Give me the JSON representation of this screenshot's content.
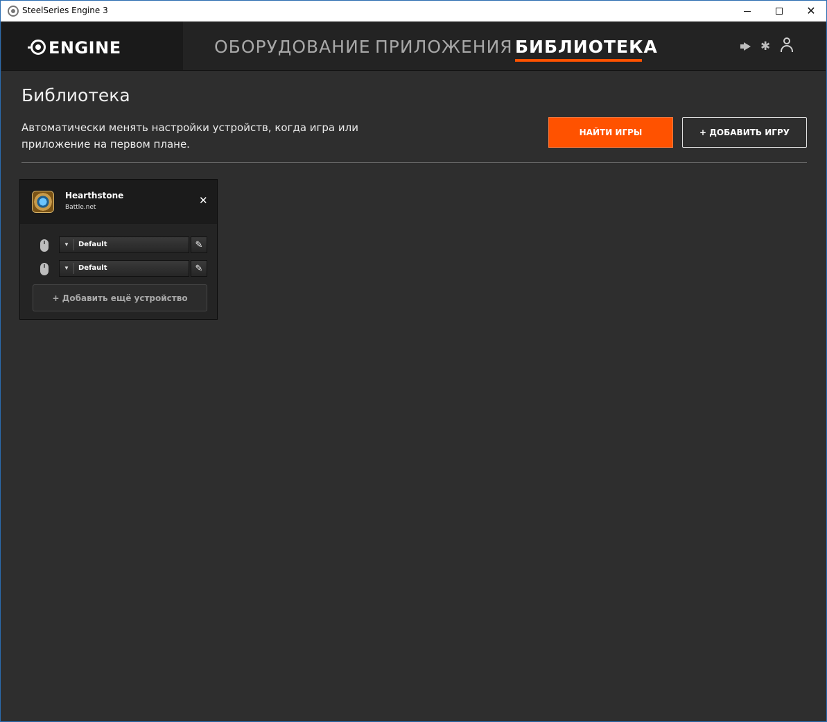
{
  "window": {
    "title": "SteelSeries Engine 3",
    "close_glyph": "✕"
  },
  "nav": {
    "logo_text": "ENGINE",
    "tabs": [
      {
        "label": "ОБОРУДОВАНИЕ",
        "active": false
      },
      {
        "label": "ПРИЛОЖЕНИЯ",
        "active": false
      },
      {
        "label": "БИБЛИОТЕКА",
        "active": true
      }
    ],
    "icons": [
      "megaphone-icon",
      "gear-icon",
      "user-icon"
    ],
    "accent_color": "#ff5200",
    "gear_glyph": "✱"
  },
  "page": {
    "title": "Библиотека",
    "description": "Автоматически менять настройки устройств, когда игра или приложение на первом плане.",
    "find_games_label": "НАЙТИ ИГРЫ",
    "add_game_label": "+ ДОБАВИТЬ ИГРУ"
  },
  "games": [
    {
      "name": "Hearthstone",
      "platform": "Battle.net",
      "close_glyph": "✕",
      "devices": [
        {
          "icon": "mouse-icon",
          "profile": "Default",
          "caret": "▼",
          "edit_glyph": "✎"
        },
        {
          "icon": "mouse-icon",
          "profile": "Default",
          "caret": "▼",
          "edit_glyph": "✎"
        }
      ],
      "add_device_label": "+ Добавить ещё устройство"
    }
  ]
}
